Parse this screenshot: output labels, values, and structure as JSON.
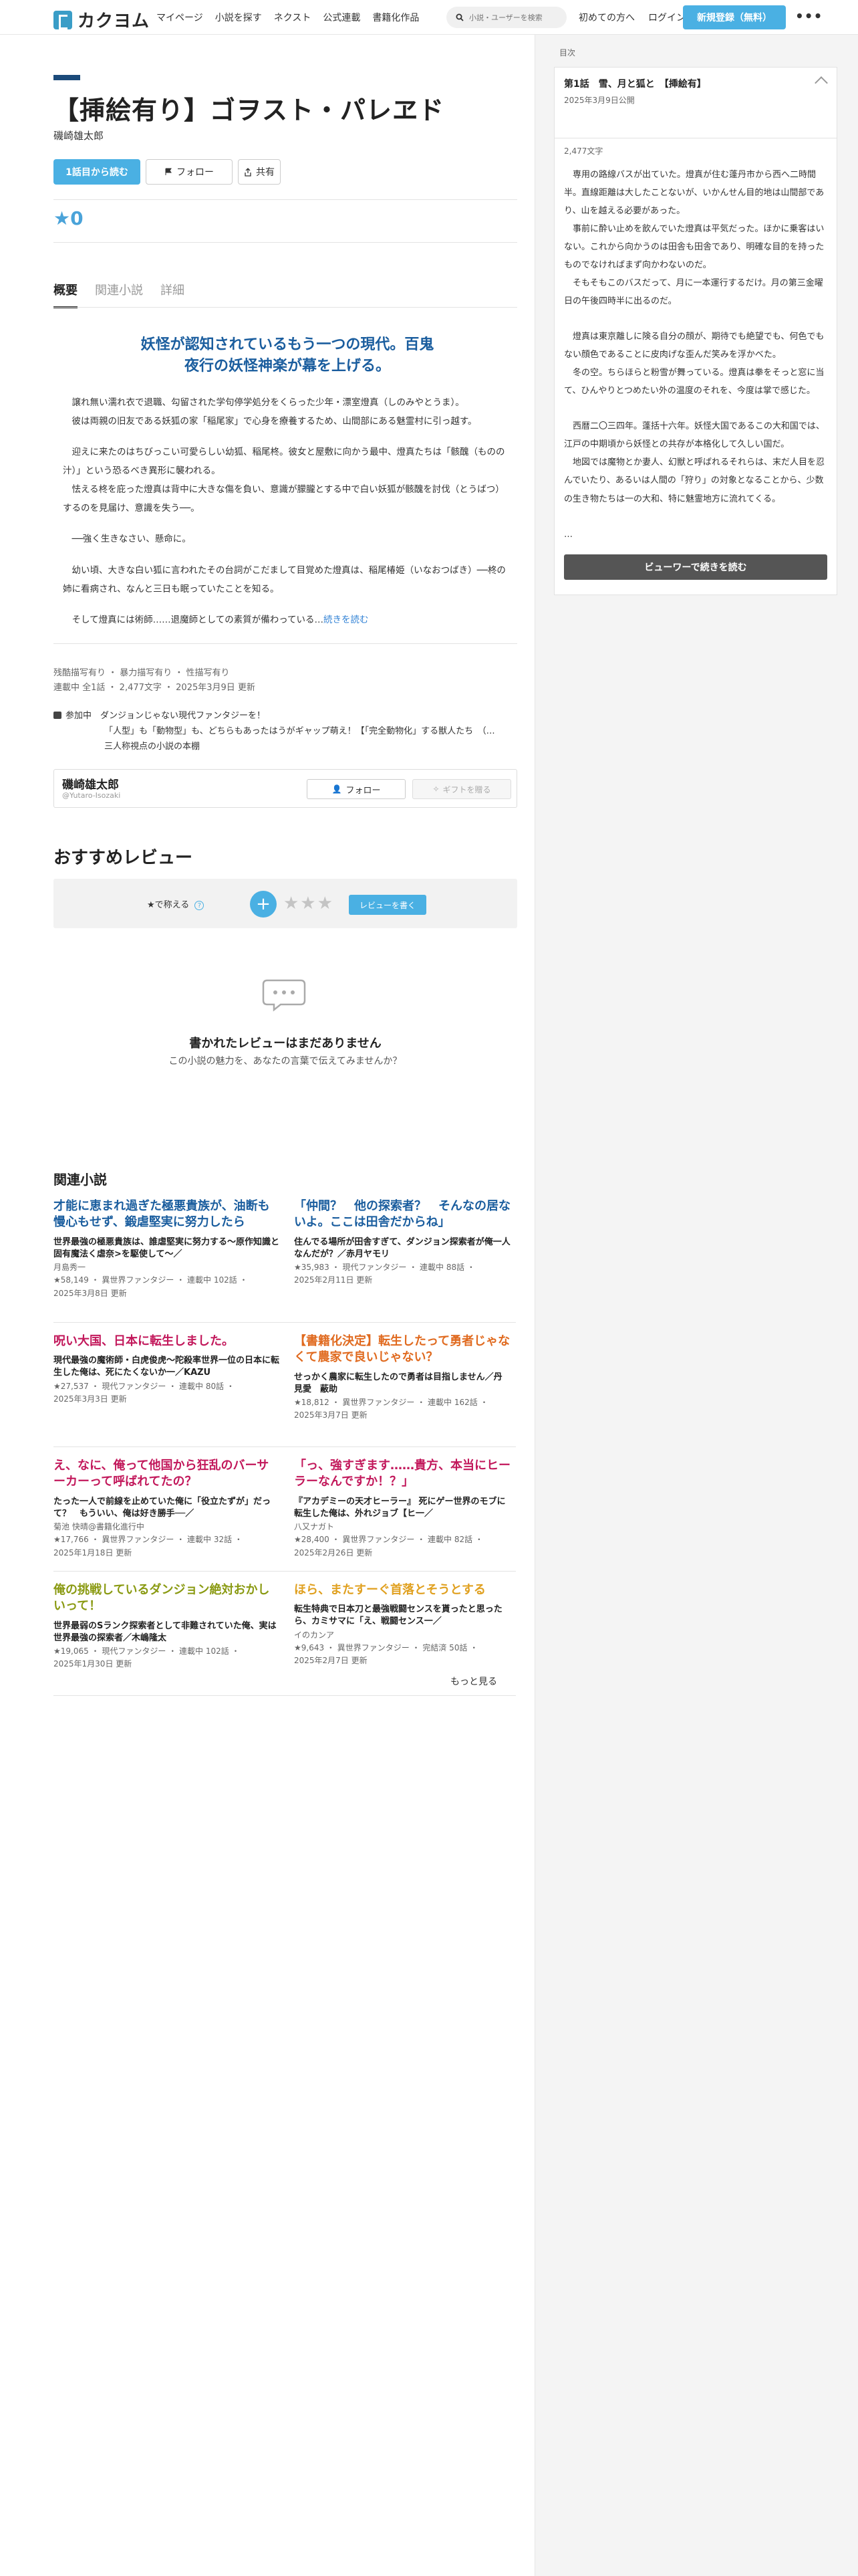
{
  "header": {
    "logo_text": "カクヨム",
    "nav": [
      "マイページ",
      "小説を探す",
      "ネクスト",
      "公式連載",
      "書籍化作品"
    ],
    "search_placeholder": "小説・ユーザーを検索",
    "first_visit": "初めての方へ",
    "login": "ログイン",
    "signup": "新規登録（無料）",
    "more": "•••"
  },
  "work": {
    "title": "【挿絵有り】ゴヲスト・パレヱド",
    "author": "磯崎雄太郎",
    "read_first": "1話目から読む",
    "follow": "フォロー",
    "share": "共有",
    "stars": "★0"
  },
  "tabs": [
    {
      "label": "概要"
    },
    {
      "label": "関連小説"
    },
    {
      "label": "詳細"
    }
  ],
  "catch": "妖怪が認知されているもう一つの現代。百鬼夜行の妖怪神楽が幕を上げる。",
  "intro": [
    "　譲れ無い濡れ衣で退職、勾留された学句停学処分をくらった少年・漂室燈真（しのみやとうま）。",
    "　彼は両親の旧友である妖狐の家「稲尾家」で心身を療養するため、山間部にある魅霊村に引っ越す。",
    "　迎えに来たのはちびっこい可愛らしい幼狐、稲尾柊。彼女と屋敷に向かう最中、燈真たちは「骸醜（ものの汁）」という恐るべき異形に襲われる。",
    "　怯える柊を庇った燈真は背中に大きな傷を負い、意識が朦朧とする中で白い妖狐が骸醜を討伐（とうばつ）するのを見届け、意識を失う──。",
    "　──強く生きなさい、懸命に。",
    "　幼い頃、大きな白い狐に言われたその台詞がこだまして目覚めた燈真は、稲尾椿姫（いなおつばき）──柊の姉に看病され、なんと三日も眠っていたことを知る。"
  ],
  "intro_last": "　そして燈真には術師……退魔師としての素質が備わっている…",
  "intro_more": "続きを読む",
  "tags_line1": "残酷描写有り ・ 暴力描写有り ・ 性描写有り",
  "tags_line2": "連載中 全1話 ・ 2,477文字 ・ 2025年3月9日 更新",
  "events_label": "参加中",
  "events": [
    "ダンジョンじゃない現代ファンタジーを！",
    "「人型」も「動物型」も、どちらもあったはうがギャップ萌え！【「完全動物化」する獣人たち　（…",
    "三人称視点の小説の本棚"
  ],
  "author_card": {
    "name": "磯崎雄太郎",
    "handle": "@Yutaro-Isozaki",
    "follow": "フォロー",
    "gift": "ギフトを贈る"
  },
  "reviews": {
    "title": "おすすめレビュー",
    "teach": "★で称える",
    "help": "?",
    "plus": "+",
    "stars": "★★★",
    "write": "レビューを書く",
    "empty_title": "書かれたレビューはまだありません",
    "empty_sub": "この小説の魅力を、あなたの言葉で伝えてみませんか？"
  },
  "related": {
    "title": "関連小説",
    "more": "もっと見る",
    "items": [
      {
        "title": "才能に恵まれ過ぎた極悪貴族が、油断も慢心もせず、鍛虐堅実に努力したら",
        "color": "#1a5d9e",
        "desc": "世界最強の極悪貴族は、誰虐堅実に努力する〜原作知識と固有魔法く虐奈>を駆使して〜／",
        "author": "月島秀一",
        "meta1": "★58,149 ・ 異世界ファンタジー ・ 連載中 102話 ・",
        "meta2": "2025年3月8日 更新"
      },
      {
        "title": "「仲間？　他の探索者？　そんなの居ないよ。ここは田舎だからね」",
        "color": "#1a5d9e",
        "desc": "住んでる場所が田舎すぎて、ダンジョン探索者が俺一人なんだが？／赤月ヤモリ",
        "author": "",
        "meta1": "★35,983 ・ 現代ファンタジー ・ 連載中 88話 ・",
        "meta2": "2025年2月11日 更新"
      },
      {
        "title": "呪い大国、日本に転生しました。",
        "color": "#c2185b",
        "desc": "現代最強の魔術師・白虎俊虎〜陀殺率世界一位の日本に転生した俺は、死にたくないか一／KAZU",
        "author": "",
        "meta1": "★27,537 ・ 現代ファンタジー ・ 連載中 80話 ・",
        "meta2": "2025年3月3日 更新"
      },
      {
        "title": "【書籍化決定】転生したって勇者じゃなくて農家で良いじゃない？",
        "color": "#e06a1f",
        "desc": "せっかく農家に転生したので勇者は目指しません／丹見愛　蔽助",
        "author": "",
        "meta1": "★18,812 ・ 異世界ファンタジー ・ 連載中 162話 ・",
        "meta2": "2025年3月7日 更新"
      },
      {
        "title": "え、なに、俺って他国から狂乱のバーサーカーって呼ばれてたの？",
        "color": "#c2185b",
        "desc": "たった一人で前線を止めていた俺に「役立たずが」だって？　もういい、俺は好き勝手──／",
        "author": "菊池 快晴@書籍化進行中",
        "meta1": "★17,766 ・ 異世界ファンタジー ・ 連載中 32話 ・",
        "meta2": "2025年1月18日 更新"
      },
      {
        "title": "「っ、強すぎます……貴方、本当にヒーラーなんですか！？」",
        "color": "#c2185b",
        "desc": "『アカデミーの天才ヒーラー』 死にゲー世界のモブに転生した俺は、外れジョブ【ヒ一／",
        "author": "八又ナガト",
        "meta1": "★28,400 ・ 異世界ファンタジー ・ 連載中 82話 ・",
        "meta2": "2025年2月26日 更新"
      },
      {
        "title": "俺の挑戦しているダンジョン絶対おかしいって！",
        "color": "#8a9a12",
        "desc": "世界最弱のSランク探索者として非難されていた俺、実は世界最強の探索者／木嶋隆太",
        "author": "",
        "meta1": "★19,065 ・ 現代ファンタジー ・ 連載中 102話 ・",
        "meta2": "2025年1月30日 更新"
      },
      {
        "title": "ほら、またすーぐ首落とそうとする",
        "color": "#e0a01f",
        "desc": "転生特典で日本刀と最強戦闘センスを貰ったと思ったら、カミサマに「え、戦闘センス一／",
        "author": "イのカンア",
        "meta1": "★9,643 ・ 異世界ファンタジー ・ 完結済 50話 ・",
        "meta2": "2025年2月7日 更新"
      }
    ]
  },
  "sidebar": {
    "label": "目次",
    "episode_title": "第1話　雪、月と狐と　【挿絵有】",
    "episode_date": "2025年3月9日公開",
    "chars": "2,477文字",
    "body": [
      "専用の路線バスが出ていた。燈真が住む蓬丹市から西へ二時間半。直線距離は大したことないが、いかんせん目的地は山間部であり、山を越える必要があった。",
      "事前に酔い止めを飲んでいた燈真は平気だった。ほかに乗客はいない。これから向かうのは田舎も田舎であり、明確な目的を持ったものでなければまず向かわないのだ。",
      "そもそもこのバスだって、月に一本運行するだけ。月の第三金曜日の午後四時半に出るのだ。",
      "",
      "燈真は東京離しに険る自分の顔が、期待でも絶望でも、何色でもない顔色であることに皮肉げな歪んだ笑みを浮かべた。",
      "冬の空。ちらほらと粉雪が舞っている。燈真は拳をそっと窓に当て、ひんやりとつめたい外の温度のそれを、今度は掌で感じた。",
      "",
      "西暦二〇三四年。蓬括十六年。妖怪大国であるこの大和国では、江戸の中期頃から妖怪との共存が本格化して久しい国だ。",
      "地図では魔物とか妻人、幻獣と呼ばれるそれらは、末だ人目を忍んでいたり、あるいは人間の「狩り」の対象となることから、少数の生き物たちは一の大和、特に魅霊地方に流れてくる。"
    ],
    "ellipsis": "…",
    "read_on": "ビューワーで続きを読む"
  }
}
